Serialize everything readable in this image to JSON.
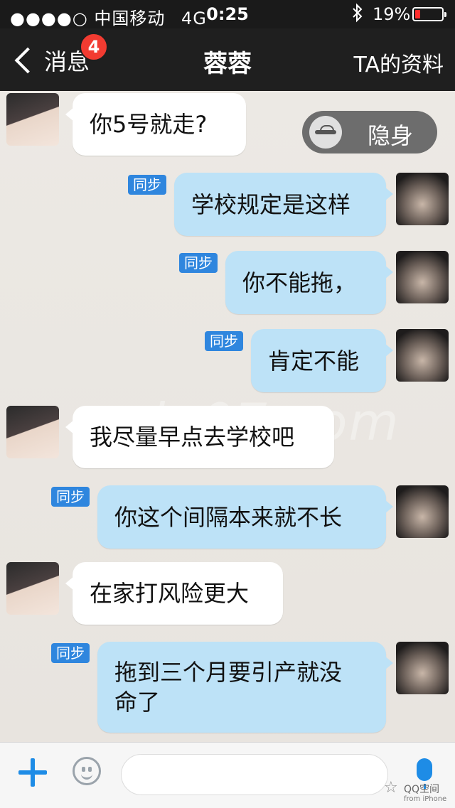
{
  "status_bar": {
    "signal": "●●●●○",
    "carrier": "中国移动",
    "network": "4G",
    "time": "0:25",
    "battery_percent": "19%",
    "battery_level": 0.19
  },
  "nav": {
    "back_label": "消息",
    "badge_count": "4",
    "title": "蓉蓉",
    "profile_label": "TA的资料"
  },
  "stealth_button": {
    "label": "隐身"
  },
  "watermark": "xiu07.com",
  "sync_label": "同步",
  "messages": [
    {
      "side": "in",
      "text": "你5号就走?"
    },
    {
      "side": "out",
      "text": "学校规定是这样"
    },
    {
      "side": "out",
      "text": "你不能拖，"
    },
    {
      "side": "out",
      "text": "肯定不能"
    },
    {
      "side": "in",
      "text": "我尽量早点去学校吧"
    },
    {
      "side": "out",
      "text": "你这个间隔本来就不长"
    },
    {
      "side": "in",
      "text": "在家打风险更大"
    },
    {
      "side": "out",
      "text": "拖到三个月要引产就没\n命了"
    }
  ],
  "footer": {
    "brand": "QQ空间",
    "brand_sub": "from iPhone"
  }
}
